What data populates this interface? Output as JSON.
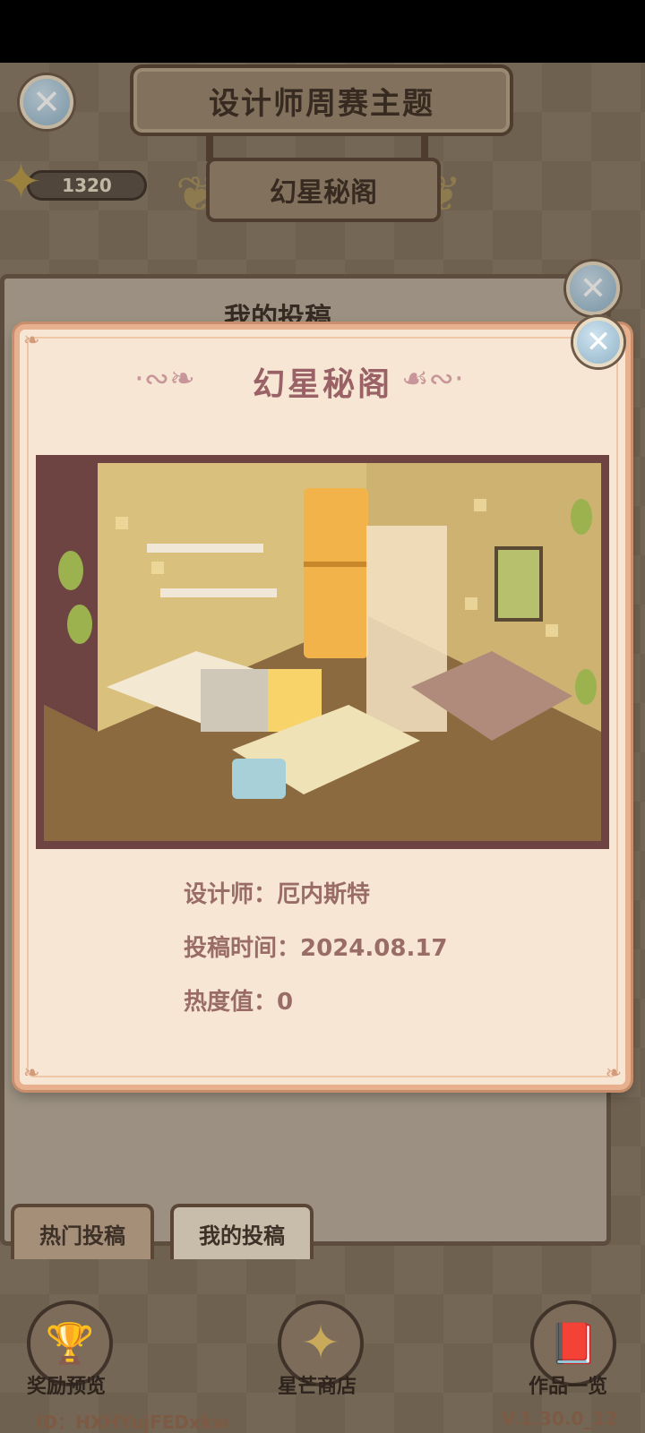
{
  "header": {
    "title": "设计师周赛主题",
    "theme_name": "幻星秘阁",
    "star_count": "1320"
  },
  "underlying_panel": {
    "title": "我的投稿"
  },
  "dialog": {
    "title": "幻星秘阁",
    "designer_label": "设计师：",
    "designer_name": "厄内斯特",
    "submit_time_label": "投稿时间：",
    "submit_time_value": "2024.08.17",
    "popularity_label": "热度值：",
    "popularity_value": "0"
  },
  "tabs": [
    {
      "label": "热门投稿",
      "selected": false
    },
    {
      "label": "我的投稿",
      "selected": true
    }
  ],
  "bottom_nav": [
    {
      "label": "奖励预览",
      "icon": "trophy-icon"
    },
    {
      "label": "星芒商店",
      "icon": "star-shop-icon"
    },
    {
      "label": "作品一览",
      "icon": "book-icon"
    }
  ],
  "footer": {
    "user_id": "ID：HXHYujFEDxkw",
    "version": "V.1.30.0_12"
  },
  "colors": {
    "dialog_bg": "#f7e6d3",
    "dialog_border": "#e7b08e",
    "title_text": "#9a6266",
    "info_text": "#9a6c66"
  }
}
